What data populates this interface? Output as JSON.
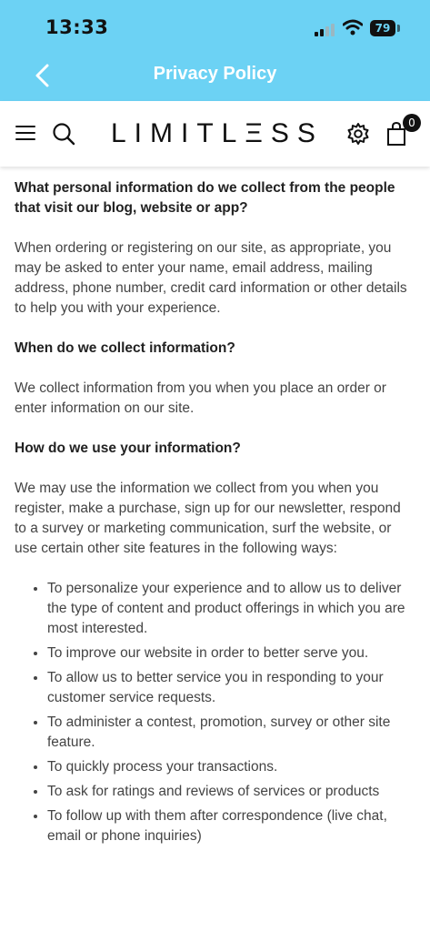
{
  "status_bar": {
    "time": "13:33",
    "battery": "79"
  },
  "nav": {
    "title": "Privacy Policy"
  },
  "header": {
    "logo": "LIMITLΞSS",
    "cart_count": "0"
  },
  "content": {
    "q1": "What personal information do we collect from the people that visit our blog, website or app?",
    "p1": "When ordering or registering on our site, as appropriate, you may be asked to enter your name, email address, mailing address, phone number, credit card information or other details to help you with your experience.",
    "q2": "When do we collect information?",
    "p2": "We collect information from you when you place an order or enter information on our site.",
    "q3": "How do we use your information?",
    "p3": "We may use the information we collect from you when you register, make a purchase, sign up for our newsletter, respond to a survey or marketing communication, surf the website, or use certain other site features in the following ways:",
    "bullets": [
      "To personalize your experience and to allow us to deliver the type of content and product offerings in which you are most interested.",
      "To improve our website in order to better serve you.",
      "To allow us to better service you in responding to your customer service requests.",
      "To administer a contest, promotion, survey or other site feature.",
      "To quickly process your transactions.",
      "To ask for ratings and reviews of services or products",
      "To follow up with them after correspondence (live chat, email or phone inquiries)"
    ]
  },
  "colors": {
    "accent": "#6cd2f4",
    "text": "#3d3d3d"
  }
}
